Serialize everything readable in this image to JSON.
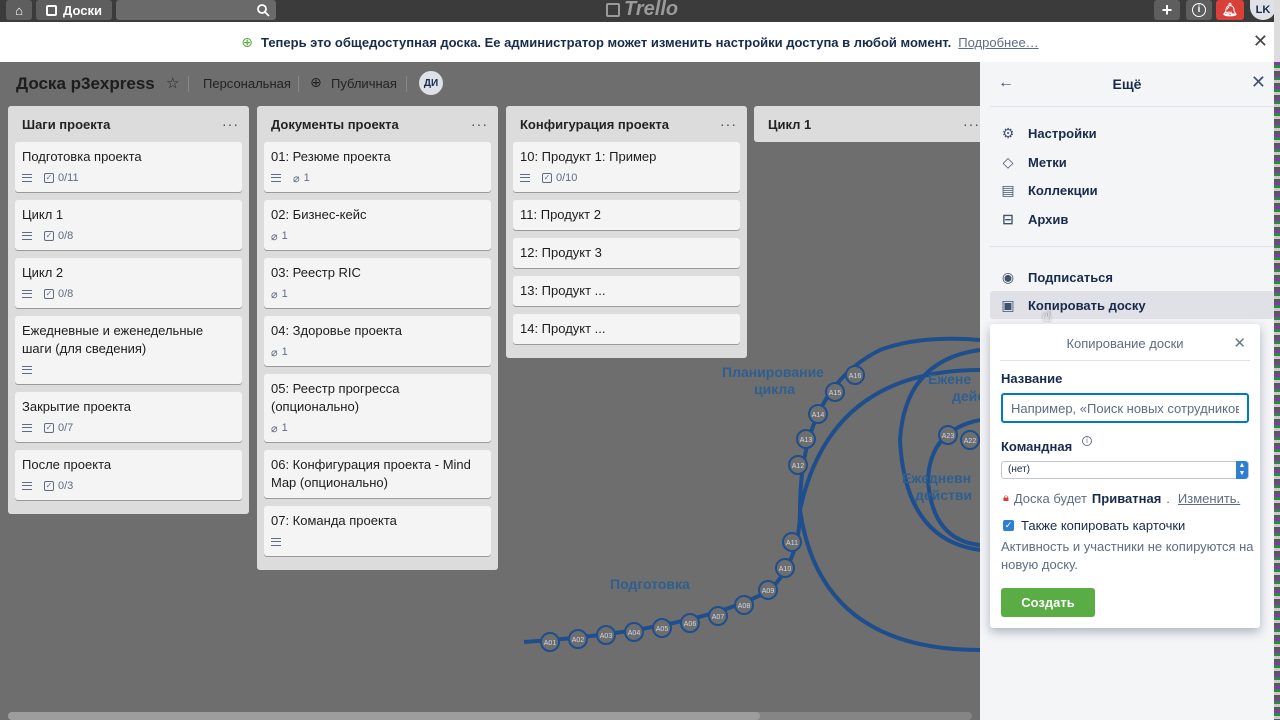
{
  "topbar": {
    "boards_label": "Доски",
    "logo_text": "Trello",
    "avatar_initials": "LK"
  },
  "banner": {
    "message": "Теперь это общедоступная доска. Ее администратор может изменить настройки доступа в любой момент.",
    "more_link": "Подробнее…"
  },
  "board": {
    "title": "Доска p3express",
    "visibility_team": "Персональная",
    "visibility_public": "Публичная",
    "member_initials": "ДИ"
  },
  "lists": [
    {
      "title": "Шаги проекта",
      "cards": [
        {
          "title": "Подготовка проекта",
          "checklist": "0/11"
        },
        {
          "title": "Цикл 1",
          "checklist": "0/8"
        },
        {
          "title": "Цикл 2",
          "checklist": "0/8"
        },
        {
          "title": "Ежедневные и еженедельные шаги (для сведения)",
          "checklist": ""
        },
        {
          "title": "Закрытие проекта",
          "checklist": "0/7"
        },
        {
          "title": "После проекта",
          "checklist": "0/3"
        }
      ]
    },
    {
      "title": "Документы проекта",
      "cards": [
        {
          "title": "01: Резюме проекта",
          "attachments": "1"
        },
        {
          "title": "02: Бизнес-кейс",
          "attachments": "1"
        },
        {
          "title": "03: Реестр RIC",
          "attachments": "1"
        },
        {
          "title": "04: Здоровье проекта",
          "attachments": "1"
        },
        {
          "title": "05: Реестр прогресса (опционально)",
          "attachments": "1"
        },
        {
          "title": "06: Конфигурация проекта - Mind Map (опционально)"
        },
        {
          "title": "07: Команда проекта"
        }
      ]
    },
    {
      "title": "Конфигурация проекта",
      "cards": [
        {
          "title": "10: Продукт 1: Пример",
          "checklist": "0/10"
        },
        {
          "title": "11: Продукт 2"
        },
        {
          "title": "12: Продукт 3"
        },
        {
          "title": "13: Продукт ..."
        },
        {
          "title": "14: Продукт ..."
        }
      ]
    },
    {
      "title": "Цикл 1"
    }
  ],
  "diagram": {
    "labels": [
      "Подготовка",
      "Планирование",
      "цикла",
      "Ежене",
      "дейс",
      "Ежедневн",
      "действи"
    ],
    "nodes": [
      "A01",
      "A02",
      "A03",
      "A04",
      "A05",
      "A06",
      "A07",
      "A08",
      "A09",
      "A10",
      "A11",
      "A12",
      "A13",
      "A14",
      "A15",
      "A16",
      "A22",
      "A23"
    ],
    "color": "#1f4e8c"
  },
  "sidemenu": {
    "title": "Ещё",
    "items": [
      {
        "label": "Настройки",
        "icon": "gear-icon"
      },
      {
        "label": "Метки",
        "icon": "tag-icon"
      },
      {
        "label": "Коллекции",
        "icon": "collection-icon"
      },
      {
        "label": "Архив",
        "icon": "archive-icon"
      },
      {
        "label": "Подписаться",
        "icon": "eye-icon"
      },
      {
        "label": "Копировать доску",
        "icon": "copy-board-icon"
      }
    ]
  },
  "copy_popover": {
    "title": "Копирование доски",
    "name_label": "Название",
    "name_placeholder": "Например, «Поиск новых сотрудников",
    "team_label": "Командная",
    "team_value": "(нет)",
    "private_prefix": "Доска будет",
    "private_word": "Приватная",
    "change_link": "Изменить.",
    "copy_cards_label": "Также копировать карточки",
    "note": "Активность и участники не копируются на новую доску.",
    "create_button": "Создать"
  }
}
